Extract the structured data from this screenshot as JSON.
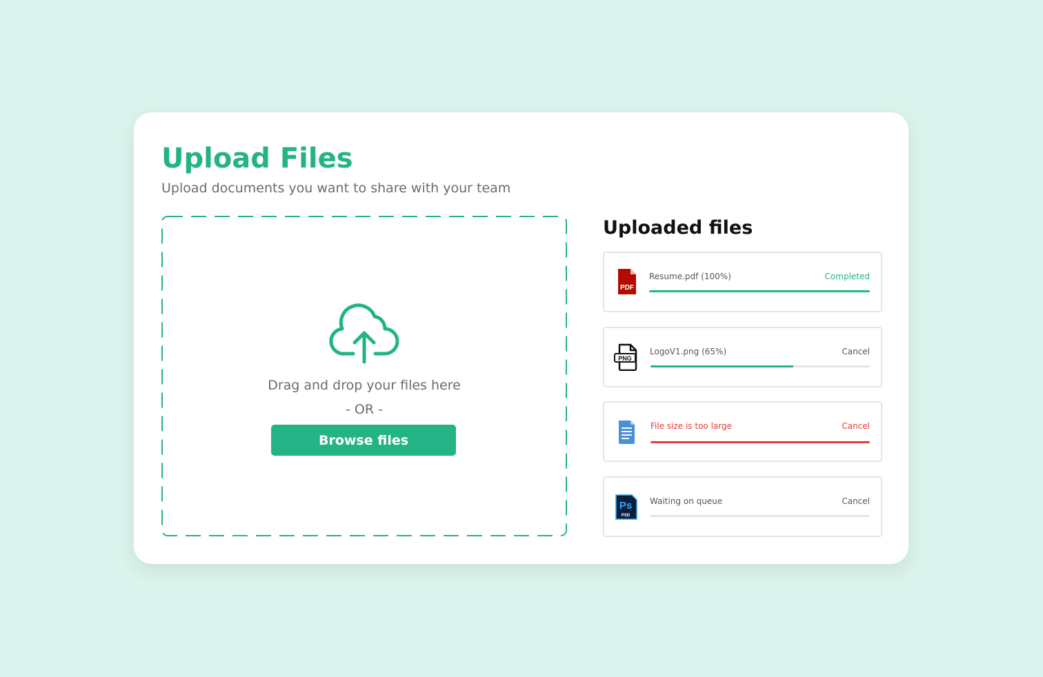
{
  "header": {
    "title": "Upload Files",
    "subtitle": "Upload documents you want to share with your team"
  },
  "dropzone": {
    "icon": "cloud-upload-icon",
    "drag_text": "Drag and drop your files here",
    "or_text": "- OR -",
    "browse_label": "Browse files"
  },
  "uploaded": {
    "title": "Uploaded files",
    "files": [
      {
        "icon": "pdf-file-icon",
        "icon_label": "PDF",
        "name": "Resume.pdf (100%)",
        "status": "Completed",
        "progress": 1.0,
        "state": "completed"
      },
      {
        "icon": "png-file-icon",
        "icon_label": "PNG",
        "name": "LogoV1.png (65%)",
        "status": "Cancel",
        "progress": 0.65,
        "state": "uploading"
      },
      {
        "icon": "document-file-icon",
        "name": "File size is too large",
        "status": "Cancel",
        "progress": 1.0,
        "state": "error"
      },
      {
        "icon": "psd-file-icon",
        "icon_label": "Ps",
        "icon_sublabel": "PSD",
        "name": "Waiting on queue",
        "status": "Cancel",
        "progress": 0,
        "state": "queued"
      }
    ]
  },
  "colors": {
    "background": "#dcf2ec",
    "accent": "#23b384",
    "error": "#e53935",
    "muted_text": "#6b6b6b"
  }
}
